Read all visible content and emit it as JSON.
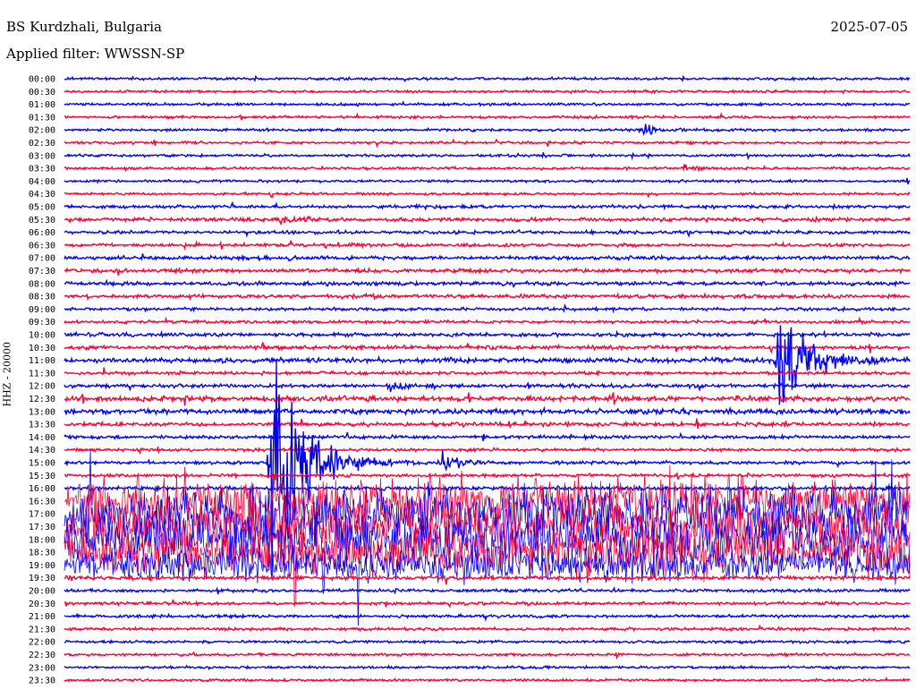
{
  "header": {
    "station": "BS Kurdzhali, Bulgaria",
    "date": "2025-07-05",
    "filter": "Applied filter: WWSSN-SP"
  },
  "chart_data": {
    "type": "line",
    "title": "BS Kurdzhali, Bulgaria",
    "subtitle": "Applied filter: WWSSN-SP",
    "ylabel": "HHZ - 20000",
    "xlabel": "",
    "minutes_per_row": 30,
    "colors": [
      "#0000ff",
      "#ff0033"
    ],
    "rows": [
      "00:00",
      "00:30",
      "01:00",
      "01:30",
      "02:00",
      "02:30",
      "03:00",
      "03:30",
      "04:00",
      "04:30",
      "05:00",
      "05:30",
      "06:00",
      "06:30",
      "07:00",
      "07:30",
      "08:00",
      "08:30",
      "09:00",
      "09:30",
      "10:00",
      "10:30",
      "11:00",
      "11:30",
      "12:00",
      "12:30",
      "13:00",
      "13:30",
      "14:00",
      "14:30",
      "15:00",
      "15:30",
      "16:00",
      "16:30",
      "17:00",
      "17:30",
      "18:00",
      "18:30",
      "19:00",
      "19:30",
      "20:00",
      "20:30",
      "21:00",
      "21:30",
      "22:00",
      "22:30",
      "23:00",
      "23:30"
    ],
    "noise_level_by_row": [
      1,
      1,
      1,
      1,
      1,
      1,
      1,
      1,
      1,
      1,
      1.3,
      1.5,
      1.3,
      1.3,
      1.5,
      1.5,
      1.5,
      1.5,
      1.2,
      1.2,
      1.5,
      1.5,
      2,
      1.3,
      1.5,
      2,
      2,
      1.5,
      1.3,
      1.2,
      1.2,
      1.2,
      1.5,
      20,
      22,
      22,
      22,
      20,
      14,
      1.5,
      1.2,
      1.2,
      1.2,
      1.2,
      1,
      1,
      1,
      1
    ],
    "events": [
      {
        "row": "02:00",
        "minute": 20.5,
        "amplitude": 5,
        "duration_min": 1.2
      },
      {
        "row": "03:30",
        "minute": 22.0,
        "amplitude": 3,
        "duration_min": 1.0
      },
      {
        "row": "11:00",
        "minute": 25.3,
        "amplitude": 40,
        "duration_min": 2.5
      },
      {
        "row": "15:00",
        "minute": 7.3,
        "amplitude": 110,
        "duration_min": 2.5
      },
      {
        "row": "15:00",
        "minute": 13.4,
        "amplitude": 10,
        "duration_min": 1.2
      },
      {
        "row": "12:00",
        "minute": 11.5,
        "amplitude": 3,
        "duration_min": 2.0
      },
      {
        "row": "05:30",
        "minute": 7.5,
        "amplitude": 3,
        "duration_min": 2.0
      }
    ]
  }
}
